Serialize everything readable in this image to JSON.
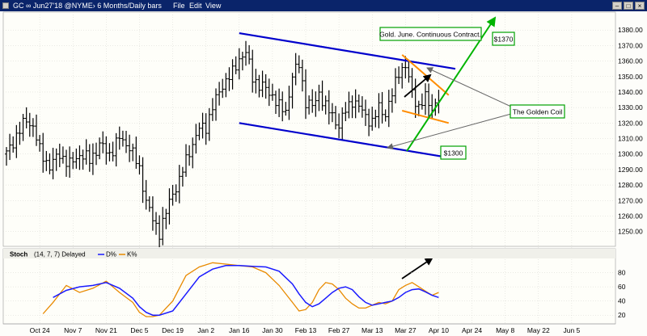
{
  "window": {
    "title": "GC ∞ Jun27'18 @NYME›  6 Months/Daily bars",
    "menu": [
      "File",
      "Edit",
      "View"
    ]
  },
  "colors": {
    "bars": "#000000",
    "channel": "#0000cc",
    "coil": "#ff8c00",
    "arrow_up": "#00b400",
    "d_line": "#1a1aff",
    "k_line": "#e88a00",
    "label_border": "#00a000"
  },
  "chart_data": [
    {
      "type": "ohlc",
      "title": "",
      "ylim": [
        1242,
        1390
      ],
      "yticks": [
        1250,
        1260,
        1270,
        1280,
        1290,
        1300,
        1310,
        1320,
        1330,
        1340,
        1350,
        1360,
        1370,
        1380
      ],
      "x_labels": [
        "Oct 24",
        "Nov 7",
        "Nov 21",
        "Dec 5",
        "Dec 19",
        "Jan 2",
        "Jan 16",
        "Jan 30",
        "Feb 13",
        "Feb 27",
        "Mar 13",
        "Mar 27",
        "Apr 10",
        "Apr 24",
        "May 8",
        "May 22",
        "Jun 5"
      ],
      "x_label_idx": [
        10,
        20,
        30,
        40,
        50,
        60,
        70,
        80,
        90,
        100,
        110,
        120,
        130,
        140,
        150,
        160,
        170
      ],
      "x_range": [
        0,
        180
      ],
      "ohlc_seed": [
        [
          0,
          1300
        ],
        [
          3,
          1312
        ],
        [
          6,
          1322
        ],
        [
          8,
          1318
        ],
        [
          10,
          1302
        ],
        [
          13,
          1292
        ],
        [
          16,
          1300
        ],
        [
          19,
          1293
        ],
        [
          22,
          1300
        ],
        [
          25,
          1296
        ],
        [
          28,
          1306
        ],
        [
          31,
          1300
        ],
        [
          34,
          1310
        ],
        [
          37,
          1305
        ],
        [
          40,
          1290
        ],
        [
          42,
          1270
        ],
        [
          44,
          1257
        ],
        [
          46,
          1250
        ],
        [
          48,
          1262
        ],
        [
          50,
          1275
        ],
        [
          52,
          1283
        ],
        [
          55,
          1302
        ],
        [
          58,
          1316
        ],
        [
          60,
          1318
        ],
        [
          62,
          1330
        ],
        [
          65,
          1345
        ],
        [
          68,
          1352
        ],
        [
          70,
          1362
        ],
        [
          72,
          1365
        ],
        [
          74,
          1350
        ],
        [
          76,
          1344
        ],
        [
          78,
          1342
        ],
        [
          80,
          1338
        ],
        [
          82,
          1330
        ],
        [
          84,
          1328
        ],
        [
          86,
          1350
        ],
        [
          88,
          1358
        ],
        [
          90,
          1334
        ],
        [
          92,
          1330
        ],
        [
          94,
          1340
        ],
        [
          96,
          1330
        ],
        [
          98,
          1325
        ],
        [
          100,
          1318
        ],
        [
          102,
          1328
        ],
        [
          104,
          1335
        ],
        [
          106,
          1330
        ],
        [
          108,
          1325
        ],
        [
          110,
          1320
        ],
        [
          112,
          1330
        ],
        [
          114,
          1326
        ],
        [
          116,
          1338
        ],
        [
          118,
          1354
        ],
        [
          120,
          1356
        ],
        [
          122,
          1340
        ],
        [
          124,
          1330
        ],
        [
          126,
          1336
        ],
        [
          128,
          1330
        ],
        [
          130,
          1335
        ]
      ],
      "channel_upper": [
        [
          70,
          1378
        ],
        [
          135,
          1355
        ]
      ],
      "channel_lower": [
        [
          70,
          1320
        ],
        [
          135,
          1297
        ]
      ],
      "coil_upper": [
        [
          119,
          1364
        ],
        [
          133,
          1338
        ]
      ],
      "coil_lower": [
        [
          119,
          1328
        ],
        [
          133,
          1320
        ]
      ],
      "annotations": {
        "contract": "Gold. June. Continuous Contract.",
        "p1370": "$1370",
        "coil": "The Golden Coil",
        "p1300": "$1300"
      }
    },
    {
      "type": "line",
      "title": "Stoch",
      "params": "(14, 7, 7) Delayed",
      "legend": [
        "D%",
        "K%"
      ],
      "ylim": [
        10,
        100
      ],
      "yticks": [
        20,
        40,
        60,
        80
      ],
      "series": [
        {
          "name": "D%",
          "points": [
            [
              14,
              45
            ],
            [
              18,
              55
            ],
            [
              22,
              60
            ],
            [
              26,
              62
            ],
            [
              30,
              66
            ],
            [
              34,
              58
            ],
            [
              38,
              44
            ],
            [
              40,
              32
            ],
            [
              42,
              24
            ],
            [
              44,
              20
            ],
            [
              46,
              20
            ],
            [
              50,
              26
            ],
            [
              54,
              50
            ],
            [
              58,
              74
            ],
            [
              62,
              85
            ],
            [
              66,
              90
            ],
            [
              70,
              90
            ],
            [
              74,
              89
            ],
            [
              78,
              88
            ],
            [
              82,
              82
            ],
            [
              86,
              64
            ],
            [
              88,
              50
            ],
            [
              90,
              38
            ],
            [
              92,
              32
            ],
            [
              94,
              36
            ],
            [
              96,
              44
            ],
            [
              98,
              52
            ],
            [
              100,
              58
            ],
            [
              102,
              60
            ],
            [
              104,
              56
            ],
            [
              106,
              46
            ],
            [
              108,
              38
            ],
            [
              110,
              34
            ],
            [
              112,
              36
            ],
            [
              114,
              38
            ],
            [
              116,
              40
            ],
            [
              118,
              45
            ],
            [
              120,
              52
            ],
            [
              122,
              56
            ],
            [
              124,
              57
            ],
            [
              126,
              53
            ],
            [
              128,
              48
            ],
            [
              130,
              45
            ]
          ]
        },
        {
          "name": "K%",
          "points": [
            [
              11,
              22
            ],
            [
              14,
              38
            ],
            [
              18,
              62
            ],
            [
              22,
              52
            ],
            [
              26,
              58
            ],
            [
              30,
              68
            ],
            [
              34,
              52
            ],
            [
              38,
              38
            ],
            [
              40,
              24
            ],
            [
              42,
              18
            ],
            [
              44,
              18
            ],
            [
              46,
              20
            ],
            [
              50,
              40
            ],
            [
              54,
              76
            ],
            [
              58,
              88
            ],
            [
              62,
              94
            ],
            [
              66,
              92
            ],
            [
              70,
              90
            ],
            [
              74,
              88
            ],
            [
              78,
              80
            ],
            [
              82,
              62
            ],
            [
              86,
              38
            ],
            [
              88,
              26
            ],
            [
              90,
              28
            ],
            [
              92,
              38
            ],
            [
              94,
              56
            ],
            [
              96,
              66
            ],
            [
              98,
              64
            ],
            [
              100,
              56
            ],
            [
              102,
              44
            ],
            [
              104,
              36
            ],
            [
              106,
              30
            ],
            [
              108,
              30
            ],
            [
              110,
              34
            ],
            [
              112,
              38
            ],
            [
              114,
              36
            ],
            [
              116,
              40
            ],
            [
              118,
              56
            ],
            [
              120,
              62
            ],
            [
              122,
              66
            ],
            [
              124,
              60
            ],
            [
              126,
              54
            ],
            [
              128,
              48
            ],
            [
              130,
              52
            ]
          ]
        }
      ]
    }
  ]
}
